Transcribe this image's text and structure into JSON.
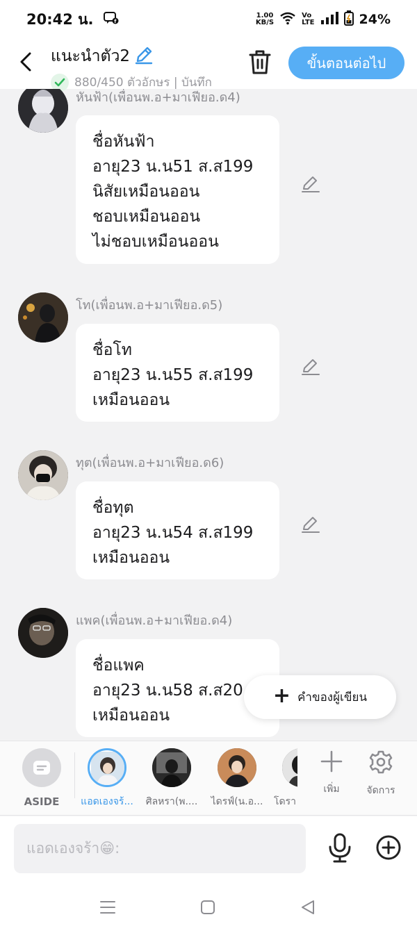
{
  "status_bar": {
    "time": "20:42 น.",
    "net_speed_value": "1.00",
    "net_speed_unit": "KB/S",
    "volte_top": "Vo",
    "volte_bottom": "LTE",
    "battery": "24%"
  },
  "header": {
    "title": "แนะนำตัว2",
    "subtitle": "880/450 ตัวอักษร | บันทึก",
    "next_label": "ขั้นตอนต่อไป"
  },
  "messages": [
    {
      "sender": "หันฟ้า(เพื่อนพ.อ+มาเฟียอ.ด4)",
      "lines": [
        "ชื่อหันฟ้า",
        "อายุ23 น.น51 ส.ส199",
        "นิสัยเหมือนออน",
        "ชอบเหมือนออน",
        "ไม่ชอบเหมือนออน"
      ]
    },
    {
      "sender": "โท(เพื่อนพ.อ+มาเฟียอ.ด5)",
      "lines": [
        "ชื่อโท",
        "อายุ23 น.น55 ส.ส199",
        "เหมือนออน"
      ]
    },
    {
      "sender": "ทุต(เพื่อนพ.อ+มาเฟียอ.ด6)",
      "lines": [
        "ชื่อทุต",
        "อายุ23 น.น54 ส.ส199",
        "เหมือนออน"
      ]
    },
    {
      "sender": "แพค(เพื่อนพ.อ+มาเฟียอ.ด4)",
      "lines": [
        "ชื่อแพค",
        "อายุ23 น.น58 ส.ส20",
        "เหมือนออน"
      ]
    }
  ],
  "author_note": {
    "label": "คำของผู้เขียน"
  },
  "characters": {
    "aside_label": "ASIDE",
    "items": [
      {
        "name": "แอดเองจร้...",
        "selected": true
      },
      {
        "name": "ศิลหรา(พ...."
      },
      {
        "name": "ไดรฟ์(น.อ..."
      },
      {
        "name": "โดรา"
      }
    ],
    "add_label": "เพิ่ม",
    "manage_label": "จัดการ"
  },
  "input": {
    "placeholder": "แอดเองจร้า😁:"
  },
  "colors": {
    "accent": "#57aef5",
    "background": "#f2f2f3",
    "bubble": "#ffffff",
    "check": "#2fb85a"
  },
  "icons": [
    "back-arrow-icon",
    "pencil-icon",
    "check-icon",
    "trash-icon",
    "edit-icon",
    "plus-icon",
    "gear-icon",
    "mic-icon",
    "add-circle-icon",
    "menu-icon",
    "home-square-icon",
    "back-triangle-icon"
  ]
}
